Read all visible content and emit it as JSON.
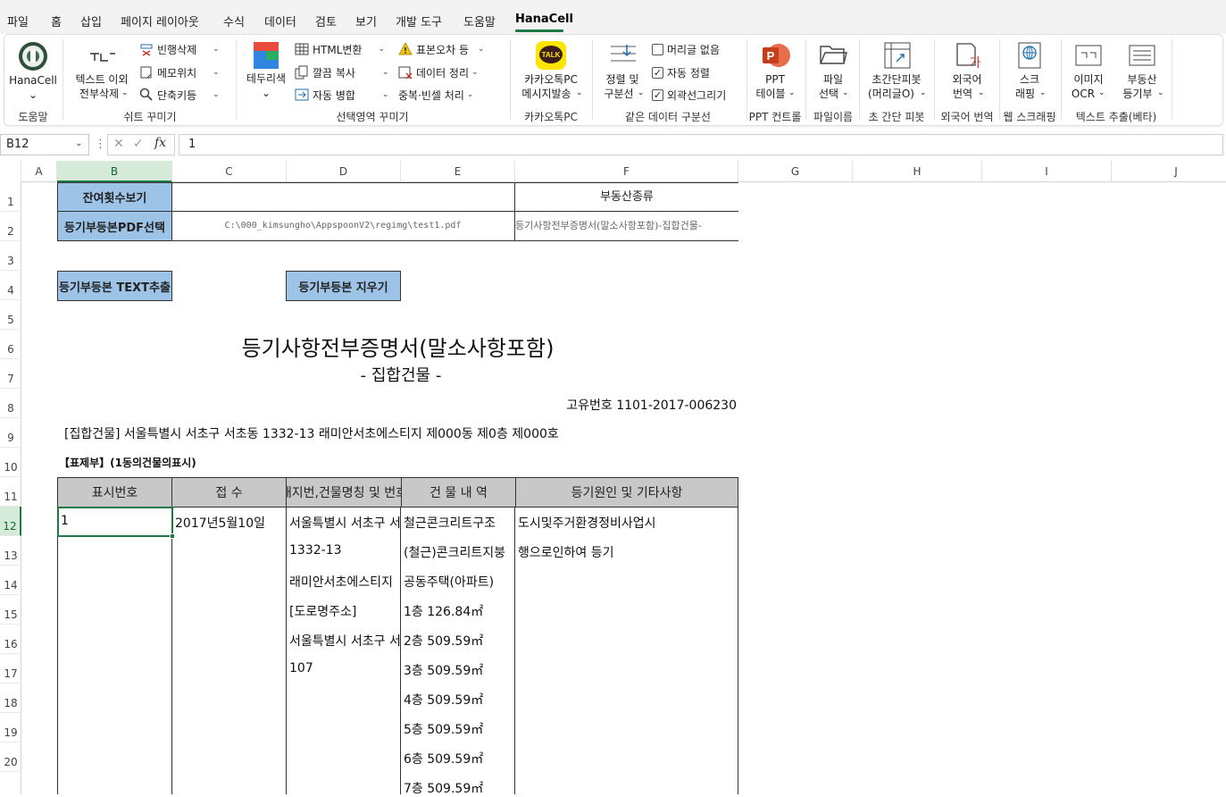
{
  "menu": {
    "items": [
      "파일",
      "홈",
      "삽입",
      "페이지 레이아웃",
      "수식",
      "데이터",
      "검토",
      "보기",
      "개발 도구",
      "도움말",
      "HanaCell"
    ]
  },
  "ribbon": {
    "hanacell": {
      "label": "HanaCell",
      "group": "도움말"
    },
    "sheet_deco": {
      "text_remove": [
        "텍스트 이외",
        "전부삭제"
      ],
      "blank_row_delete": "빈행삭제",
      "memo_position": "메모위치",
      "shortcut": "단축키등",
      "group": "쉬트 꾸미기"
    },
    "selection_deco": {
      "border_color": "테두리색",
      "html_convert": "HTML변환",
      "clean_copy": "깔끔 복사",
      "auto_merge": "자동 병합",
      "stderr": "표본오차 등",
      "data_cleanup": "데이터 정리",
      "dup_blank": "중복·빈셀 처리",
      "group": "선택영역 꾸미기"
    },
    "kakao": {
      "label": [
        "카카오톡PC",
        "메시지발송"
      ],
      "group": "카카오톡PC",
      "talk": "TALK"
    },
    "divider": {
      "sort_divider": [
        "정렬 및",
        "구분선"
      ],
      "no_header": "머리글 없음",
      "auto_sort": "자동 정렬",
      "outline": "외곽선그리기",
      "group": "같은 데이터 구분선"
    },
    "ppt": {
      "label": [
        "PPT",
        "테이블"
      ],
      "group": "PPT 컨트롤"
    },
    "file": {
      "label": [
        "파일",
        "선택"
      ],
      "group": "파일이름"
    },
    "pivot": {
      "label": [
        "초간단피봇",
        "(머리글O)"
      ],
      "group": "초 간단 피봇"
    },
    "translate": {
      "label": [
        "외국어",
        "번역"
      ],
      "group": "외국어 번역"
    },
    "scrape": {
      "label": [
        "스크",
        "래핑"
      ],
      "group": "웹 스크래핑"
    },
    "ocr": {
      "label": [
        "이미지",
        "OCR"
      ],
      "group": "텍스트 추출(베타)"
    },
    "realestate": {
      "label": [
        "부동산",
        "등기부"
      ]
    }
  },
  "formula_bar": {
    "name_box": "B12",
    "fx": "fx",
    "value": "1"
  },
  "columns": [
    "A",
    "B",
    "C",
    "D",
    "E",
    "F",
    "G",
    "H",
    "I",
    "J"
  ],
  "rows": [
    "1",
    "2",
    "3",
    "4",
    "5",
    "6",
    "7",
    "8",
    "9",
    "10",
    "11",
    "12",
    "13",
    "14",
    "15",
    "16",
    "17",
    "18",
    "19",
    "20"
  ],
  "sheet": {
    "remaining_label": "잔여횟수보기",
    "property_type_label": "부동산종류",
    "pdf_select_label": "등기부등본PDF선택",
    "pdf_path": "C:\\000_kimsungho\\AppspoonV2\\regimg\\test1.pdf",
    "property_type_value": "등기사항전부증명서(말소사항포함)-집합건물-",
    "extract_button": "등기부등본 TEXT추출",
    "clear_button": "등기부등본 지우기",
    "doc_title": "등기사항전부증명서(말소사항포함)",
    "doc_subtitle": "- 집합건물 -",
    "unique_number": "고유번호 1101-2017-006230",
    "address_line": "[집합건물] 서울특별시 서초구 서초동 1332-13 래미안서초에스티지 제000동 제0층 제000호",
    "section_title": "【표제부】(1동의건물의표시)",
    "table_headers": [
      "표시번호",
      "접  수",
      "소재지번,건물명칭 및 번호",
      "건 물 내 역",
      "등기원인 및 기타사항"
    ],
    "col_b": [
      "1"
    ],
    "col_c": [
      "2017년5월10일"
    ],
    "col_d": [
      "서울특별시 서초구 서초동",
      "1332-13",
      "래미안서초에스티지",
      "[도로명주소]",
      "서울특별시 서초구 서초대로",
      "107"
    ],
    "col_e": [
      "철근콘크리트구조",
      "(철근)콘크리트지붕",
      "공동주택(아파트)",
      "1층 126.84㎡",
      "2층 509.59㎡",
      "3층 509.59㎡",
      "4층 509.59㎡",
      "5층 509.59㎡",
      "6층 509.59㎡",
      "7층 509.59㎡"
    ],
    "col_f": [
      "도시및주거환경정비사업시",
      "행으로인하여 등기"
    ]
  }
}
